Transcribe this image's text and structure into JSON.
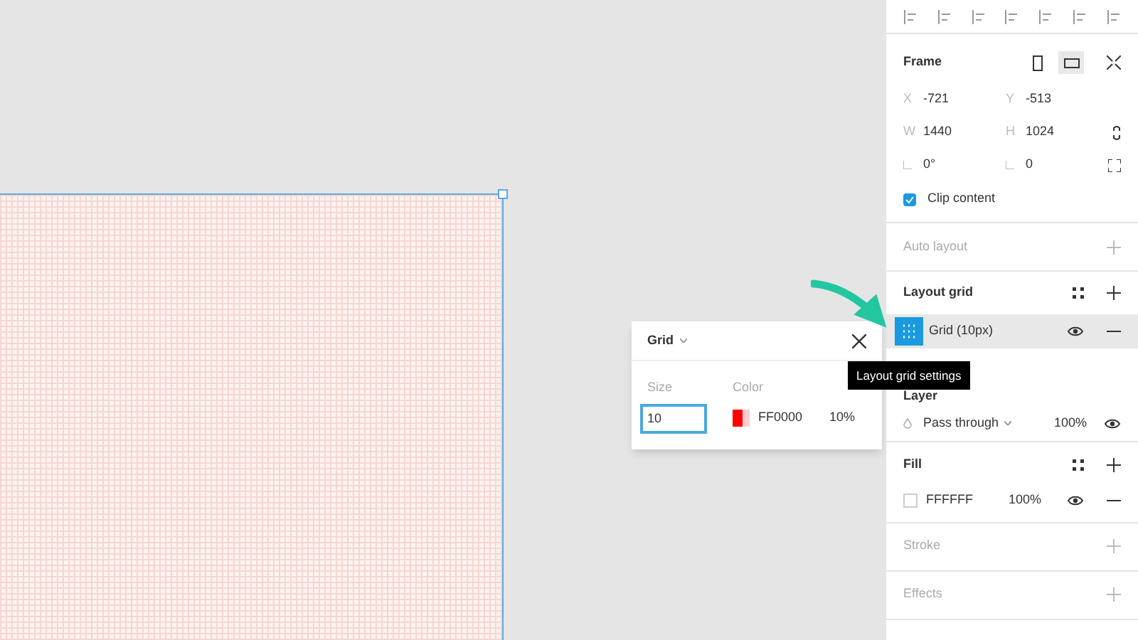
{
  "frame_section": {
    "title": "Frame",
    "orientation": [
      {
        "selected": false
      },
      {
        "selected": true
      }
    ],
    "fields": [
      {
        "label": "X",
        "value": "-721"
      },
      {
        "label": "Y",
        "value": "-513"
      },
      {
        "label": "W",
        "value": "1440"
      },
      {
        "label": "H",
        "value": "1024"
      },
      {
        "value": "0°"
      },
      {
        "value": "0"
      }
    ],
    "clip_content": {
      "label": "Clip content",
      "checked": true
    }
  },
  "auto_layout": {
    "title": "Auto layout"
  },
  "layout_grid": {
    "title": "Layout grid",
    "items": [
      {
        "label": "Grid (10px)",
        "selected": true
      }
    ]
  },
  "tooltip": "Layout grid settings",
  "layer": {
    "title": "Layer",
    "blend": "Pass through",
    "opacity": "100%"
  },
  "fill": {
    "title": "Fill",
    "hex": "FFFFFF",
    "opacity": "100%"
  },
  "stroke": {
    "title": "Stroke"
  },
  "effects": {
    "title": "Effects"
  },
  "grid_popup": {
    "title": "Grid",
    "size_label": "Size",
    "color_label": "Color",
    "size": "10",
    "color": "#ff0000",
    "hex": "FF0000",
    "opacity": "10%"
  }
}
